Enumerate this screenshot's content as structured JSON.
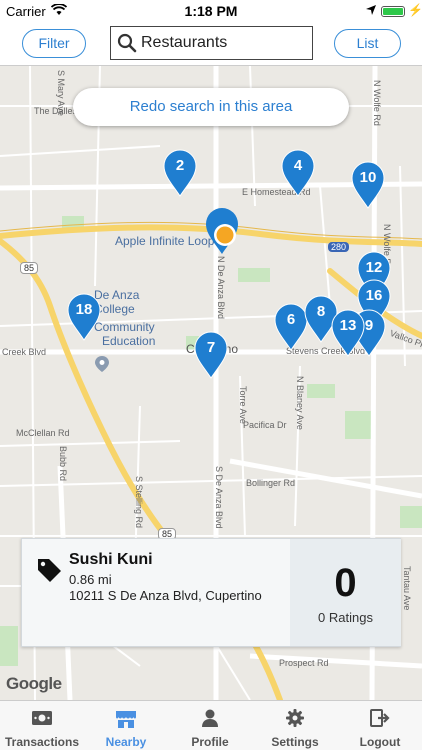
{
  "status_bar": {
    "carrier": "Carrier",
    "time": "1:18 PM"
  },
  "top_bar": {
    "filter_label": "Filter",
    "list_label": "List",
    "search_value": "Restaurants"
  },
  "map": {
    "redo_label": "Redo search in this area",
    "google_label": "Google",
    "place_labels": {
      "apple": "Apple Infinite Loop",
      "de_anza": "De Anza",
      "college": "College",
      "community": "Community",
      "education": "Education",
      "cupertino": "Cupertino"
    },
    "road_labels": {
      "dalles": "The Dalles Ave",
      "homestead": "E Homestead Rd",
      "wolfe": "N Wolfe Rd",
      "wolfe2": "N Wolfe Rd",
      "de_anza_blvd": "N De Anza Blvd",
      "s_de_anza": "S De Anza Blvd",
      "stevens_creek": "Stevens Creek Blvd",
      "creek_blvd": "Creek Blvd",
      "mcclellan": "McClellan Rd",
      "pacifica": "Pacifica Dr",
      "bollinger": "Bollinger Rd",
      "prospect": "Prospect Rd",
      "torre": "Torre Ave",
      "blaney": "N Blaney Ave",
      "stelling": "S Stelling Rd",
      "bubb": "Bubb Rd",
      "vallco": "Vallco Pky",
      "mary": "S Mary Ave",
      "tantau": "Tantau Ave",
      "hwy85a": "85",
      "hwy85b": "85",
      "hwy280": "280"
    },
    "markers": [
      "2",
      "4",
      "10",
      "12",
      "16",
      "18",
      "6",
      "8",
      "13",
      "9",
      "7"
    ]
  },
  "card": {
    "name": "Sushi Kuni",
    "distance": "0.86 mi",
    "address": "10211 S De Anza Blvd, Cupertino",
    "rating_count": "0",
    "rating_label": "0 Ratings"
  },
  "tabs": [
    {
      "label": "Transactions",
      "icon": "money-icon"
    },
    {
      "label": "Nearby",
      "icon": "store-icon"
    },
    {
      "label": "Profile",
      "icon": "person-icon"
    },
    {
      "label": "Settings",
      "icon": "gear-icon"
    },
    {
      "label": "Logout",
      "icon": "logout-icon"
    }
  ],
  "colors": {
    "accent": "#2c7fd0",
    "marker": "#1f7ed0",
    "active_tab": "#4a90e2",
    "user_location": "#f5a623"
  }
}
